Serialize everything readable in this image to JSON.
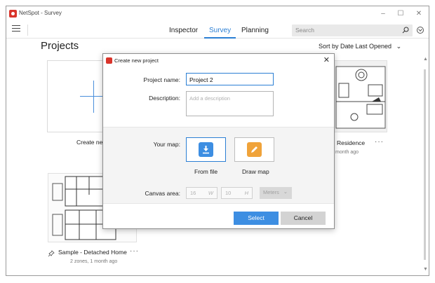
{
  "window": {
    "title": "NetSpot - Survey",
    "controls": {
      "minimize": "–",
      "maximize": "☐",
      "close": "✕"
    }
  },
  "toolbar": {
    "tabs": [
      {
        "label": "Inspector",
        "active": false
      },
      {
        "label": "Survey",
        "active": true
      },
      {
        "label": "Planning",
        "active": false
      }
    ],
    "search": {
      "placeholder": "Search",
      "icon": "search-icon"
    }
  },
  "projects": {
    "heading": "Projects",
    "sort_label": "Sort by Date Last Opened",
    "sort_chevron": "⌄",
    "cards": [
      {
        "title": "Create new project",
        "visible_title": "Create nev"
      },
      {
        "title": "Residence",
        "meta": "1 month ago",
        "visible_meta": "month ago",
        "more": "···"
      },
      {
        "title": "Sample - Detached Home",
        "meta": "2 zones, 1 month ago",
        "more": "···"
      }
    ]
  },
  "dialog": {
    "title": "Create new project",
    "close_glyph": "✕",
    "project_name_label": "Project name:",
    "project_name_value": "Project 2",
    "description_label": "Description:",
    "description_placeholder": "Add a description",
    "your_map_label": "Your map:",
    "map_options": [
      {
        "label": "From file",
        "selected": true,
        "icon": "download-icon",
        "color": "#3d8ee2"
      },
      {
        "label": "Draw map",
        "selected": false,
        "icon": "pencil-icon",
        "color": "#f0a33a"
      }
    ],
    "canvas_area_label": "Canvas area:",
    "canvas_width": "16",
    "canvas_width_unit": "W",
    "canvas_height": "10",
    "canvas_height_unit": "H",
    "canvas_units": "Meters",
    "select_label": "Select",
    "cancel_label": "Cancel"
  },
  "colors": {
    "accent": "#2b7fd4",
    "select_button": "#3d8ee2",
    "draw_map_icon": "#f0a33a",
    "app_icon": "#d9342b"
  }
}
